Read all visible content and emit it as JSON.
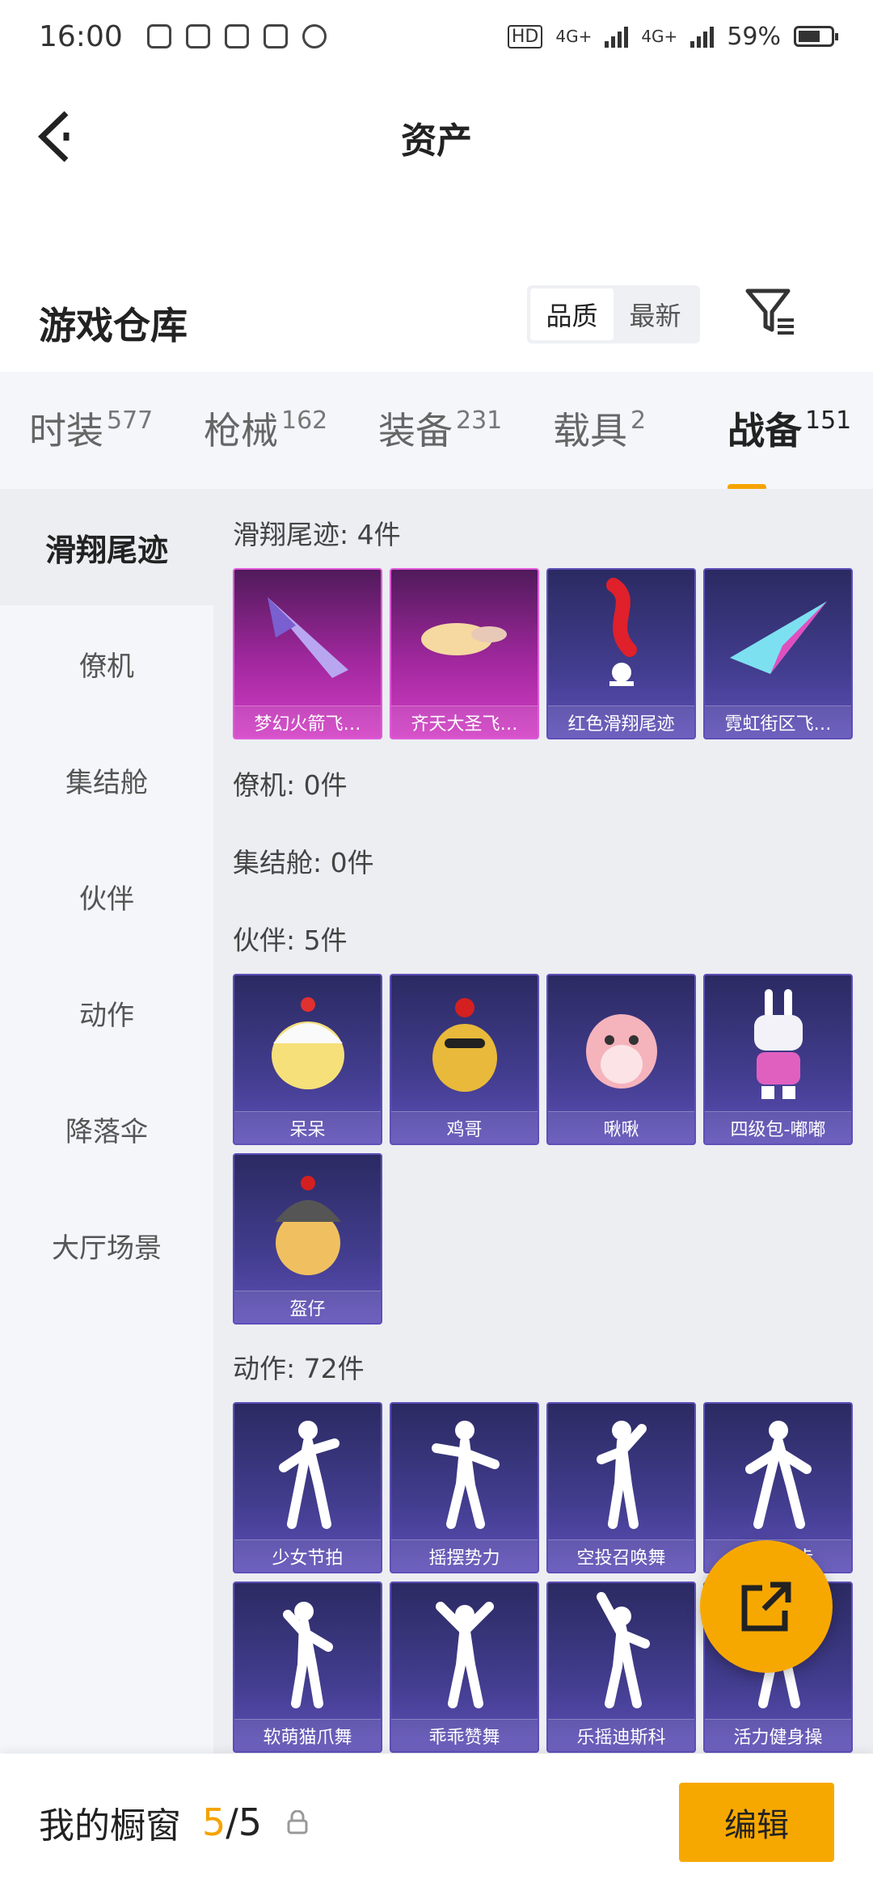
{
  "status_bar": {
    "time": "16:00",
    "battery": "59%",
    "net1": "4G+",
    "net2": "4G+"
  },
  "header": {
    "title": "资产"
  },
  "warehouse": {
    "title": "游戏仓库",
    "sort_options": [
      "品质",
      "最新"
    ],
    "active_sort": "品质"
  },
  "tabs": [
    {
      "label": "时装",
      "count": "577"
    },
    {
      "label": "枪械",
      "count": "162"
    },
    {
      "label": "装备",
      "count": "231"
    },
    {
      "label": "载具",
      "count": "2"
    },
    {
      "label": "战备",
      "count": "151"
    }
  ],
  "sidebar": [
    "滑翔尾迹",
    "僚机",
    "集结舱",
    "伙伴",
    "动作",
    "降落伞",
    "大厅场景"
  ],
  "sections": {
    "glide": {
      "title": "滑翔尾迹: 4件",
      "items": [
        "梦幻火箭飞…",
        "齐天大圣飞…",
        "红色滑翔尾迹",
        "霓虹街区飞…"
      ]
    },
    "wingman": {
      "title": "僚机: 0件"
    },
    "pod": {
      "title": "集结舱: 0件"
    },
    "partner": {
      "title": "伙伴: 5件",
      "items": [
        "呆呆",
        "鸡哥",
        "啾啾",
        "四级包-嘟嘟",
        "盔仔"
      ]
    },
    "emote": {
      "title": "动作: 72件",
      "items": [
        "少女节拍",
        "摇摆势力",
        "空投召唤舞",
        "霹雷漫步",
        "软萌猫爪舞",
        "乖乖赞舞",
        "乐摇迪斯科",
        "活力健身操"
      ]
    }
  },
  "bottom_bar": {
    "label": "我的橱窗",
    "current": "5",
    "slash_total": "/5",
    "edit_label": "编辑"
  },
  "colors": {
    "accent": "#f7a800",
    "card_purple": "#433d8f",
    "card_pink": "#a2289f"
  }
}
